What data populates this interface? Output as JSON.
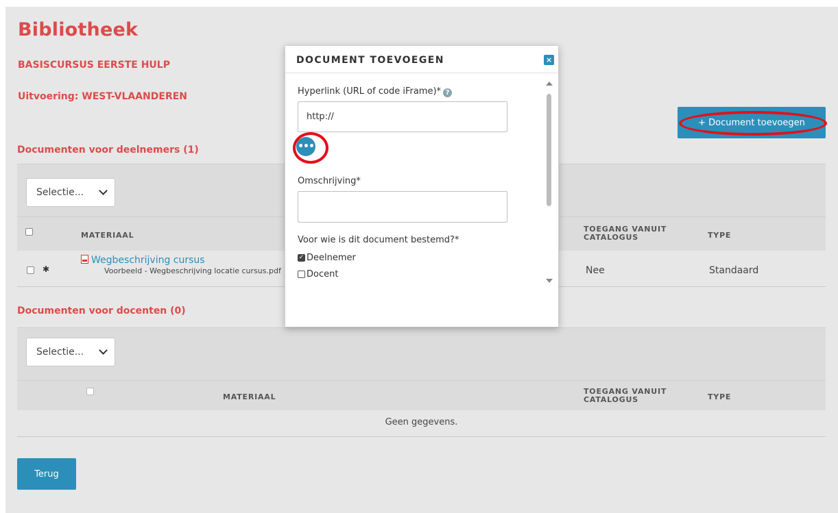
{
  "page": {
    "title": "Bibliotheek",
    "course": "BASISCURSUS EERSTE HULP",
    "execution": "Uitvoering: WEST-VLAANDEREN",
    "add_button": "+ Document toevoegen",
    "back_button": "Terug"
  },
  "participants": {
    "heading": "Documenten voor deelnemers (1)",
    "select_label": "Selectie...",
    "columns": [
      "MATERIAAL",
      "TOEGANG VANUIT CATALOGUS",
      "TYPE"
    ],
    "rows": [
      {
        "title": "Wegbeschrijving cursus",
        "file": "Voorbeeld - Wegbeschrijving locatie cursus.pdf",
        "access": "Nee",
        "type": "Standaard"
      }
    ]
  },
  "teachers": {
    "heading": "Documenten voor docenten (0)",
    "select_label": "Selectie...",
    "columns": [
      "MATERIAAL",
      "TOEGANG VANUIT CATALOGUS",
      "TYPE"
    ],
    "empty": "Geen gegevens."
  },
  "modal": {
    "title": "DOCUMENT TOEVOEGEN",
    "close": "×",
    "hyperlink_label": "Hyperlink (URL of code iFrame)*",
    "hyperlink_value": "http://",
    "dots": "•••",
    "description_label": "Omschrijving*",
    "description_value": "",
    "audience_label": "Voor wie is dit document bestemd?*",
    "options": [
      {
        "label": "Deelnemer",
        "checked": true
      },
      {
        "label": "Docent",
        "checked": false
      }
    ]
  },
  "colors": {
    "accent": "#dc4b4b",
    "primary": "#2b8fb9",
    "highlight_ring": "#e3101b"
  }
}
